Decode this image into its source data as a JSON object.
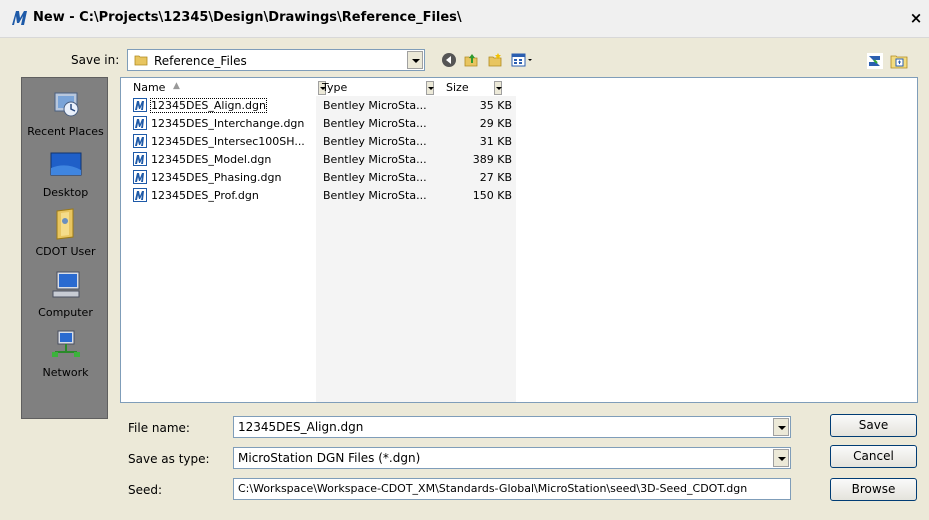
{
  "window": {
    "title": "New - C:\\Projects\\12345\\Design\\Drawings\\Reference_Files\\",
    "close_label": "×"
  },
  "savein": {
    "label": "Save in:",
    "value": "Reference_Files"
  },
  "toolbar": {
    "icons": [
      "back-icon",
      "up-folder-icon",
      "new-folder-icon",
      "views-menu-icon"
    ],
    "right_icons": [
      "refresh-icon",
      "select-folder-icon"
    ]
  },
  "places": [
    {
      "label": "Recent Places",
      "icon": "recent-places-icon"
    },
    {
      "label": "Desktop",
      "icon": "desktop-icon"
    },
    {
      "label": "CDOT User",
      "icon": "user-folder-icon"
    },
    {
      "label": "Computer",
      "icon": "computer-icon"
    },
    {
      "label": "Network",
      "icon": "network-icon"
    }
  ],
  "columns": {
    "name": "Name",
    "type": "Type",
    "size": "Size"
  },
  "files": [
    {
      "name": "12345DES_Align.dgn",
      "type": "Bentley MicroSta...",
      "size": "35 KB"
    },
    {
      "name": "12345DES_Interchange.dgn",
      "type": "Bentley MicroSta...",
      "size": "29 KB"
    },
    {
      "name": "12345DES_Intersec100SH...",
      "type": "Bentley MicroSta...",
      "size": "31 KB"
    },
    {
      "name": "12345DES_Model.dgn",
      "type": "Bentley MicroSta...",
      "size": "389 KB"
    },
    {
      "name": "12345DES_Phasing.dgn",
      "type": "Bentley MicroSta...",
      "size": "27 KB"
    },
    {
      "name": "12345DES_Prof.dgn",
      "type": "Bentley MicroSta...",
      "size": "150 KB"
    }
  ],
  "form": {
    "filename_label": "File name:",
    "filename_value": "12345DES_Align.dgn",
    "saveas_label": "Save as type:",
    "saveas_value": "MicroStation DGN Files (*.dgn)",
    "seed_label": "Seed:",
    "seed_value": "C:\\Workspace\\Workspace-CDOT_XM\\Standards-Global\\MicroStation\\seed\\3D-Seed_CDOT.dgn"
  },
  "buttons": {
    "save": "Save",
    "cancel": "Cancel",
    "browse": "Browse"
  },
  "colors": {
    "dialog_bg": "#ece9d8",
    "places_bg": "#808080",
    "microstation_blue": "#1e5aa8"
  }
}
